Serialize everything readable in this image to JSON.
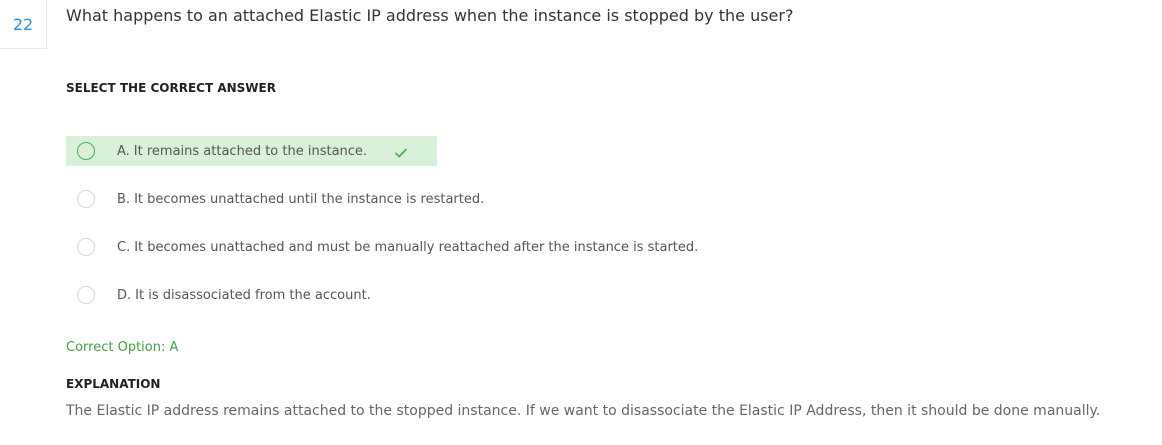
{
  "question": {
    "number": "22",
    "text": "What happens to an attached Elastic IP address when the instance is stopped by the user?"
  },
  "select_heading": "SELECT THE CORRECT ANSWER",
  "options": [
    {
      "letter": "A.",
      "text": "It remains attached to the instance.",
      "is_correct": true
    },
    {
      "letter": "B.",
      "text": "It becomes unattached until the instance is restarted.",
      "is_correct": false
    },
    {
      "letter": "C.",
      "text": "It becomes unattached and must be manually reattached after the instance is started.",
      "is_correct": false
    },
    {
      "letter": "D.",
      "text": "It is disassociated from the account.",
      "is_correct": false
    }
  ],
  "correct_option_text": "Correct Option: A",
  "explanation": {
    "heading": "EXPLANATION",
    "text": "The Elastic IP address remains attached to the stopped instance. If we want to disassociate the Elastic IP Address, then it should be done manually."
  },
  "icons": {
    "check": "check-icon",
    "radio": "radio-icon"
  },
  "colors": {
    "accent_blue": "#2d8fd5",
    "correct_green": "#43a047",
    "correct_bg": "#d9f0d9"
  }
}
